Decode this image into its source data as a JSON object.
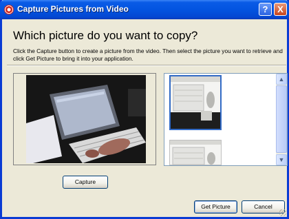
{
  "window": {
    "title": "Capture Pictures from Video",
    "help_label": "?",
    "close_label": "X"
  },
  "heading": "Which picture do you want to copy?",
  "instructions": "Click the Capture button to create a picture from the video.  Then select the picture you want to retrieve and click Get Picture to bring it into your application.",
  "buttons": {
    "capture": "Capture",
    "get_picture": "Get Picture",
    "cancel": "Cancel"
  },
  "captured_thumbnails": [
    "capture-1",
    "capture-2"
  ],
  "selected_thumbnail": 1,
  "colors": {
    "title_bar": "#0354e0",
    "dialog_bg": "#ece9d8",
    "selection": "#316ac5"
  },
  "icons": {
    "app": "camera-icon",
    "help": "help-icon",
    "close": "close-icon",
    "scroll_up": "chevron-up-icon",
    "scroll_down": "chevron-down-icon"
  }
}
